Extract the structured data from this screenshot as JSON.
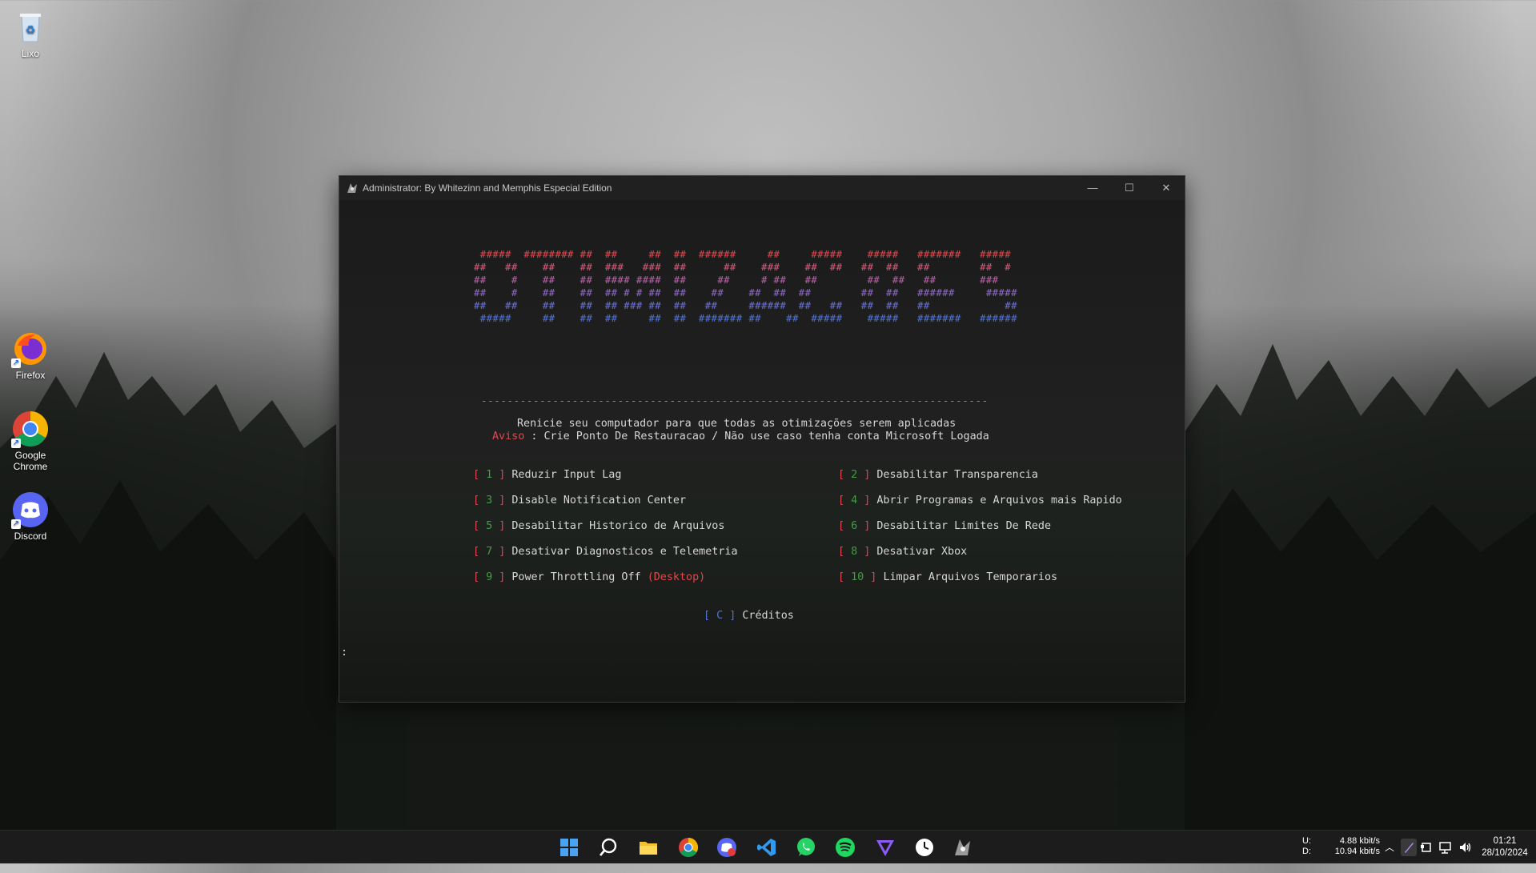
{
  "desktop": {
    "icons": [
      {
        "label": "Lixo",
        "icon": "recycle-bin-icon"
      },
      {
        "label": "Firefox",
        "icon": "firefox-icon"
      },
      {
        "label": "Google Chrome",
        "icon": "chrome-icon"
      },
      {
        "label": "Discord",
        "icon": "discord-icon"
      }
    ]
  },
  "window": {
    "title": "Administrator: By Whitezinn and Memphis Especial Edition",
    "minimize": "—",
    "maximize": "☐",
    "close": "✕"
  },
  "terminal": {
    "ascii_art": [
      " #####  ######## ##  ##     ##  ##  ######     ##     #####    #####   #######   #####",
      "##   ##    ##    ##  ###   ###  ##      ##    ###    ##  ##   ##  ##   ##        ##  #",
      "##    #    ##    ##  #### ####  ##     ##     # ##   ##        ##  ##   ##       ###",
      "##    #    ##    ##  ## # # ##  ##    ##    ##  ##  ##        ##  ##   ######     #####",
      "##   ##    ##    ##  ## ### ##  ##   ##     ######  ##   ##   ##  ##   ##            ##",
      " #####     ##    ##  ##     ##  ##  ####### ##    ##  #####    #####   #######   ######"
    ],
    "separator": "------------------------------------------------------------------------------",
    "message": "Renicie seu computador para que todas as otimizações serem aplicadas",
    "warning_label": "Aviso",
    "warning_text": " : Crie Ponto De Restauracao / Não use caso tenha conta Microsoft Logada",
    "options": [
      {
        "num": "1",
        "label": "Reduzir Input Lag"
      },
      {
        "num": "2",
        "label": "Desabilitar Transparencia"
      },
      {
        "num": "3",
        "label": "Disable Notification Center"
      },
      {
        "num": "4",
        "label": "Abrir Programas e Arquivos mais Rapido"
      },
      {
        "num": "5",
        "label": "Desabilitar Historico de Arquivos"
      },
      {
        "num": "6",
        "label": "Desabilitar Limites De Rede"
      },
      {
        "num": "7",
        "label": "Desativar Diagnosticos e Telemetria"
      },
      {
        "num": "8",
        "label": "Desativar Xbox"
      },
      {
        "num": "9",
        "label": "Power Throttling Off ",
        "suffix": "(Desktop)"
      },
      {
        "num": "10",
        "label": "Limpar Arquivos Temporarios"
      }
    ],
    "credits": {
      "key": "C",
      "label": "Créditos"
    },
    "prompt": ":"
  },
  "taskbar": {
    "apps": [
      "start-icon",
      "search-icon",
      "file-explorer-icon",
      "chrome-icon",
      "discord-icon",
      "vscode-icon",
      "whatsapp-icon",
      "spotify-icon",
      "proton-vpn-icon",
      "clock-app-icon",
      "terminal-app-icon"
    ],
    "net_upload_label": "U:",
    "net_download_label": "D:",
    "net_upload": "4.88 kbit/s",
    "net_download": "10.94 kbit/s",
    "time": "01:21",
    "date": "28/10/2024"
  },
  "colors": {
    "ascii_top": "#e0474c",
    "ascii_bottom": "#4f74d8",
    "bracket_red": "#e0474c",
    "number_green": "#3fa03f",
    "bracket_blue": "#4f74d8"
  }
}
